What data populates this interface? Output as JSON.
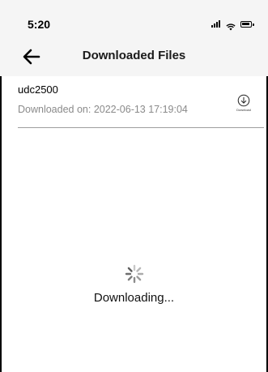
{
  "status_bar": {
    "time": "5:20",
    "icons": [
      "signal-icon",
      "wifi-icon",
      "battery-icon"
    ]
  },
  "header": {
    "title": "Downloaded Files",
    "back_icon": "back-arrow-icon"
  },
  "files": [
    {
      "name": "udc2500",
      "downloaded_on": "Downloaded on: 2022-06-13 17:19:04",
      "action_label": "Download",
      "action_icon": "download-icon"
    }
  ],
  "loading": {
    "text": "Downloading...",
    "icon": "spinner-icon"
  },
  "colors": {
    "bar_background": "#f5f5f5",
    "background": "#ffffff",
    "divider": "#9e9e9e",
    "secondary_text": "#8a8a8a"
  }
}
